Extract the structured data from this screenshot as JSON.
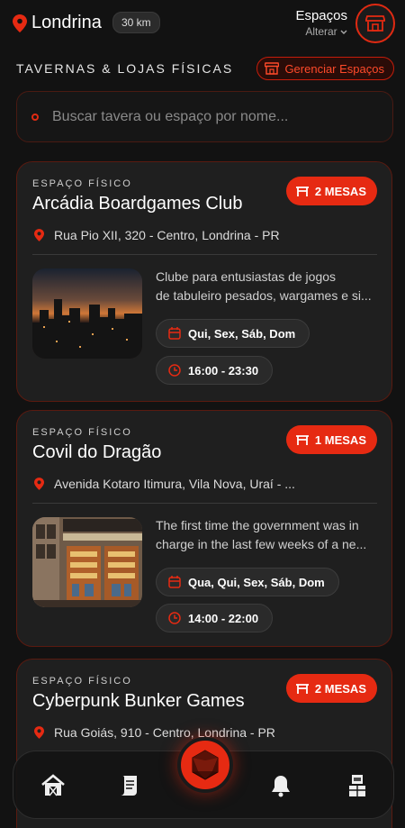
{
  "header": {
    "city": "Londrina",
    "radius": "30 km",
    "spaces_title": "Espaços",
    "change_label": "Alterar"
  },
  "section": {
    "title": "TAVERNAS & LOJAS FÍSICAS",
    "manage_label": "Gerenciar Espaços"
  },
  "search": {
    "placeholder": "Buscar tavera ou espaço por nome..."
  },
  "venues": [
    {
      "kind": "ESPAÇO FÍSICO",
      "name": "Arcádia Boardgames Club",
      "tables": "2 MESAS",
      "address": "Rua Pio XII, 320 - Centro, Londrina - PR",
      "desc_line1": "Clube para entusiastas de jogos",
      "desc_line2": "de tabuleiro pesados, wargames e si...",
      "days": "Qui, Sex, Sáb, Dom",
      "hours": "16:00 - 23:30"
    },
    {
      "kind": "ESPAÇO FÍSICO",
      "name": "Covil do Dragão",
      "tables": "1 MESAS",
      "address": "Avenida Kotaro Itimura, Vila Nova, Uraí - ...",
      "desc_line1": "The first time the government was in",
      "desc_line2": "charge in the last few weeks of a ne...",
      "days": "Qua, Qui, Sex, Sáb, Dom",
      "hours": "14:00 - 22:00"
    },
    {
      "kind": "ESPAÇO FÍSICO",
      "name": "Cyberpunk Bunker Games",
      "tables": "2 MESAS",
      "address": "Rua Goiás, 910 - Centro, Londrina - PR"
    }
  ],
  "colors": {
    "accent": "#e62a12",
    "background": "#121212",
    "card": "#1f1f1f"
  },
  "nav": {
    "items": [
      "tavern-icon",
      "scroll-icon",
      "d20-icon",
      "bell-icon",
      "knight-icon"
    ]
  }
}
